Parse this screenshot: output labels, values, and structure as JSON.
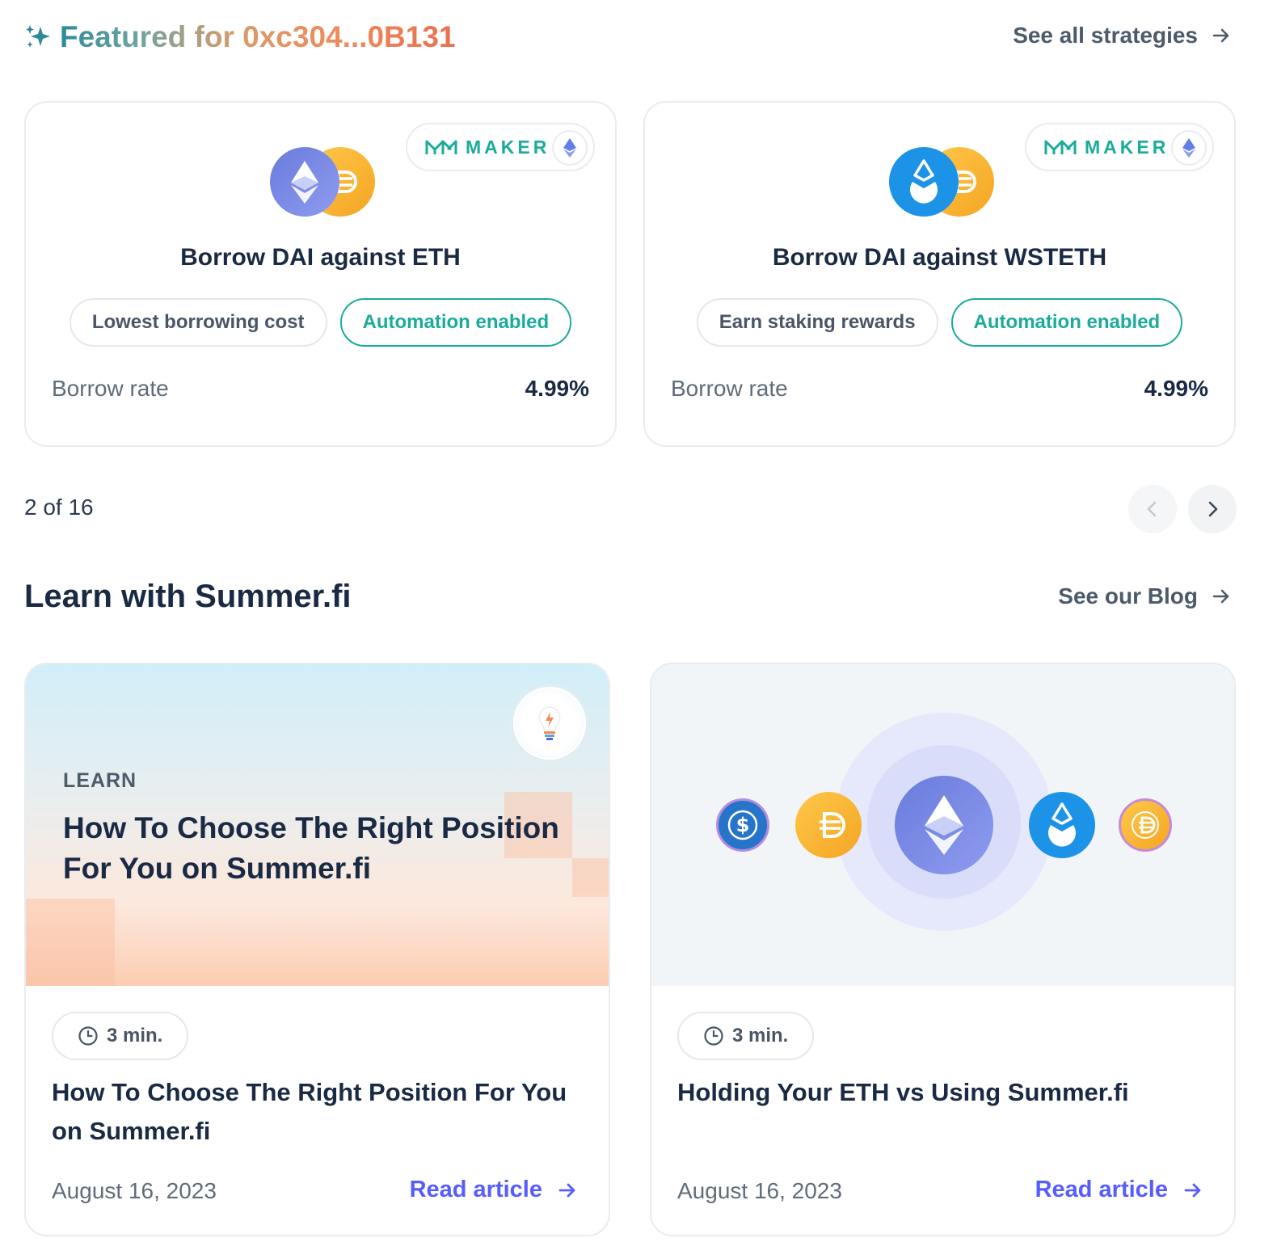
{
  "featured": {
    "title": "Featured for 0xc304...0B131",
    "see_all_label": "See all strategies"
  },
  "strategies": [
    {
      "protocol": "MAKER",
      "network_icon": "ethereum-icon",
      "collateral_icon": "eth-token-icon",
      "debt_icon": "dai-token-icon",
      "title": "Borrow DAI against ETH",
      "tags": [
        "Lowest borrowing cost",
        "Automation enabled"
      ],
      "rate_label": "Borrow rate",
      "rate_value": "4.99%"
    },
    {
      "protocol": "MAKER",
      "network_icon": "ethereum-icon",
      "collateral_icon": "wsteth-token-icon",
      "debt_icon": "dai-token-icon",
      "title": "Borrow DAI against WSTETH",
      "tags": [
        "Earn staking rewards",
        "Automation enabled"
      ],
      "rate_label": "Borrow rate",
      "rate_value": "4.99%"
    }
  ],
  "pager": {
    "text": "2 of 16"
  },
  "learn": {
    "title": "Learn with Summer.fi",
    "blog_link_label": "See our Blog"
  },
  "articles": [
    {
      "hero_label": "LEARN",
      "hero_heading": "How To Choose The Right Position For You on Summer.fi",
      "read_time": "3 min.",
      "title": "How To Choose The Right Position For You on Summer.fi",
      "date": "August 16, 2023",
      "link_label": "Read article"
    },
    {
      "read_time": "3 min.",
      "title": "Holding Your ETH vs Using Summer.fi",
      "date": "August 16, 2023",
      "link_label": "Read article"
    }
  ],
  "colors": {
    "accent_green": "#1aab9b",
    "link_purple": "#575cfe",
    "text_dark": "#1b2a44"
  }
}
